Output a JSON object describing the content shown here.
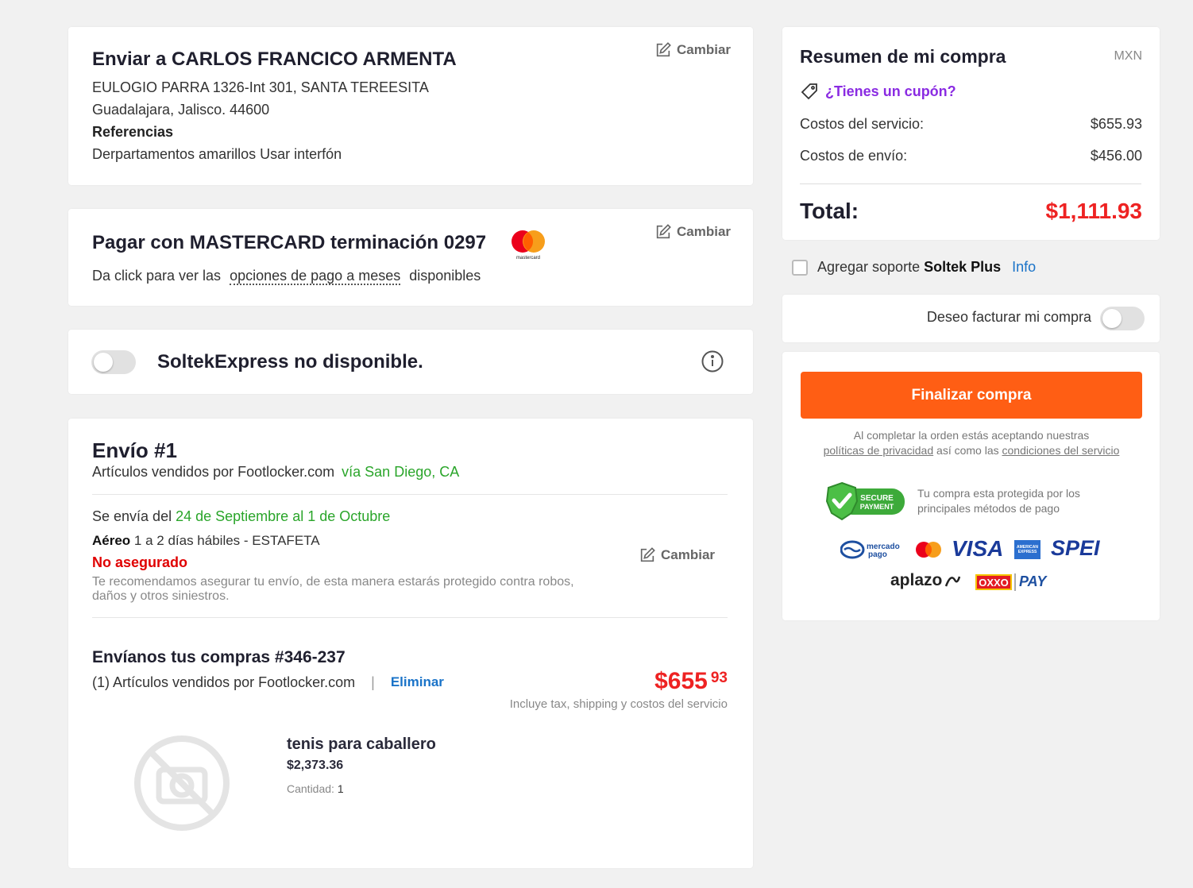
{
  "address": {
    "title": "Enviar a CARLOS FRANCICO ARMENTA",
    "street": "EULOGIO PARRA 1326-Int 301, SANTA TEREESITA",
    "city": "Guadalajara, Jalisco. 44600",
    "references_label": "Referencias",
    "references": "Derpartamentos amarillos Usar interfón",
    "change_label": "Cambiar"
  },
  "payment": {
    "title": "Pagar con MASTERCARD terminación 0297",
    "brand": "mastercard",
    "sub_prefix": "Da click para ver las",
    "sub_link": "opciones de pago a meses",
    "sub_suffix": "disponibles",
    "change_label": "Cambiar"
  },
  "express": {
    "label": "SoltekExpress no disponible."
  },
  "shipment": {
    "title": "Envío #1",
    "seller": "Artículos vendidos por Footlocker.com",
    "origin": "vía San Diego, CA",
    "window_prefix": "Se envía del",
    "window": "24 de Septiembre al 1 de Octubre",
    "method": "Aéreo",
    "method_detail": "1 a 2 días hábiles - ESTAFETA",
    "insurance_status": "No asegurado",
    "insurance_note_1": "Te recomendamos asegurar tu envío, de esta manera estarás protegido contra robos,",
    "insurance_note_2": "daños y otros siniestros.",
    "change_label": "Cambiar",
    "order_title": "Envíanos tus compras #346-237",
    "order_seller": "(1) Artículos vendidos por Footlocker.com",
    "separator": "|",
    "remove_label": "Eliminar",
    "price_main": "$655",
    "price_cents": "93",
    "price_note": "Incluye tax, shipping y costos del servicio",
    "product_name": "tenis para caballero",
    "product_price": "$2,373.36",
    "qty_label": "Cantidad:",
    "qty_value": "1"
  },
  "summary": {
    "title": "Resumen de mi compra",
    "currency": "MXN",
    "coupon": "¿Tienes un cupón?",
    "service_label": "Costos del servicio:",
    "service_value": "$655.93",
    "shipping_label": "Costos de envío:",
    "shipping_value": "$456.00",
    "total_label": "Total:",
    "total_value": "$1,111.93"
  },
  "support": {
    "prefix": "Agregar soporte",
    "brand": "Soltek Plus",
    "info": "Info"
  },
  "invoice": {
    "label": "Deseo facturar mi compra"
  },
  "checkout": {
    "button": "Finalizar compra",
    "terms_line1": "Al completar la orden estás aceptando nuestras",
    "privacy": "políticas de privacidad",
    "middle": "así como las",
    "conditions": "condiciones del servicio",
    "secure_badge_1": "SECURE",
    "secure_badge_2": "PAYMENT",
    "secure_text_1": "Tu compra esta protegida por los",
    "secure_text_2": "principales métodos de pago",
    "logo_mercado_1": "mercado",
    "logo_mercado_2": "pago",
    "logo_visa": "VISA",
    "logo_amex": "AMERICAN EXPRESS",
    "logo_spei": "SPEI",
    "logo_aplazo": "aplazo",
    "logo_oxxo": "OXXO",
    "logo_pay": "PAY"
  },
  "colors": {
    "accent_orange": "#ff5e14",
    "price_red": "#ee2222",
    "green": "#2aa52a",
    "link_blue": "#1a73c8",
    "coupon_purple": "#8a2be2"
  }
}
